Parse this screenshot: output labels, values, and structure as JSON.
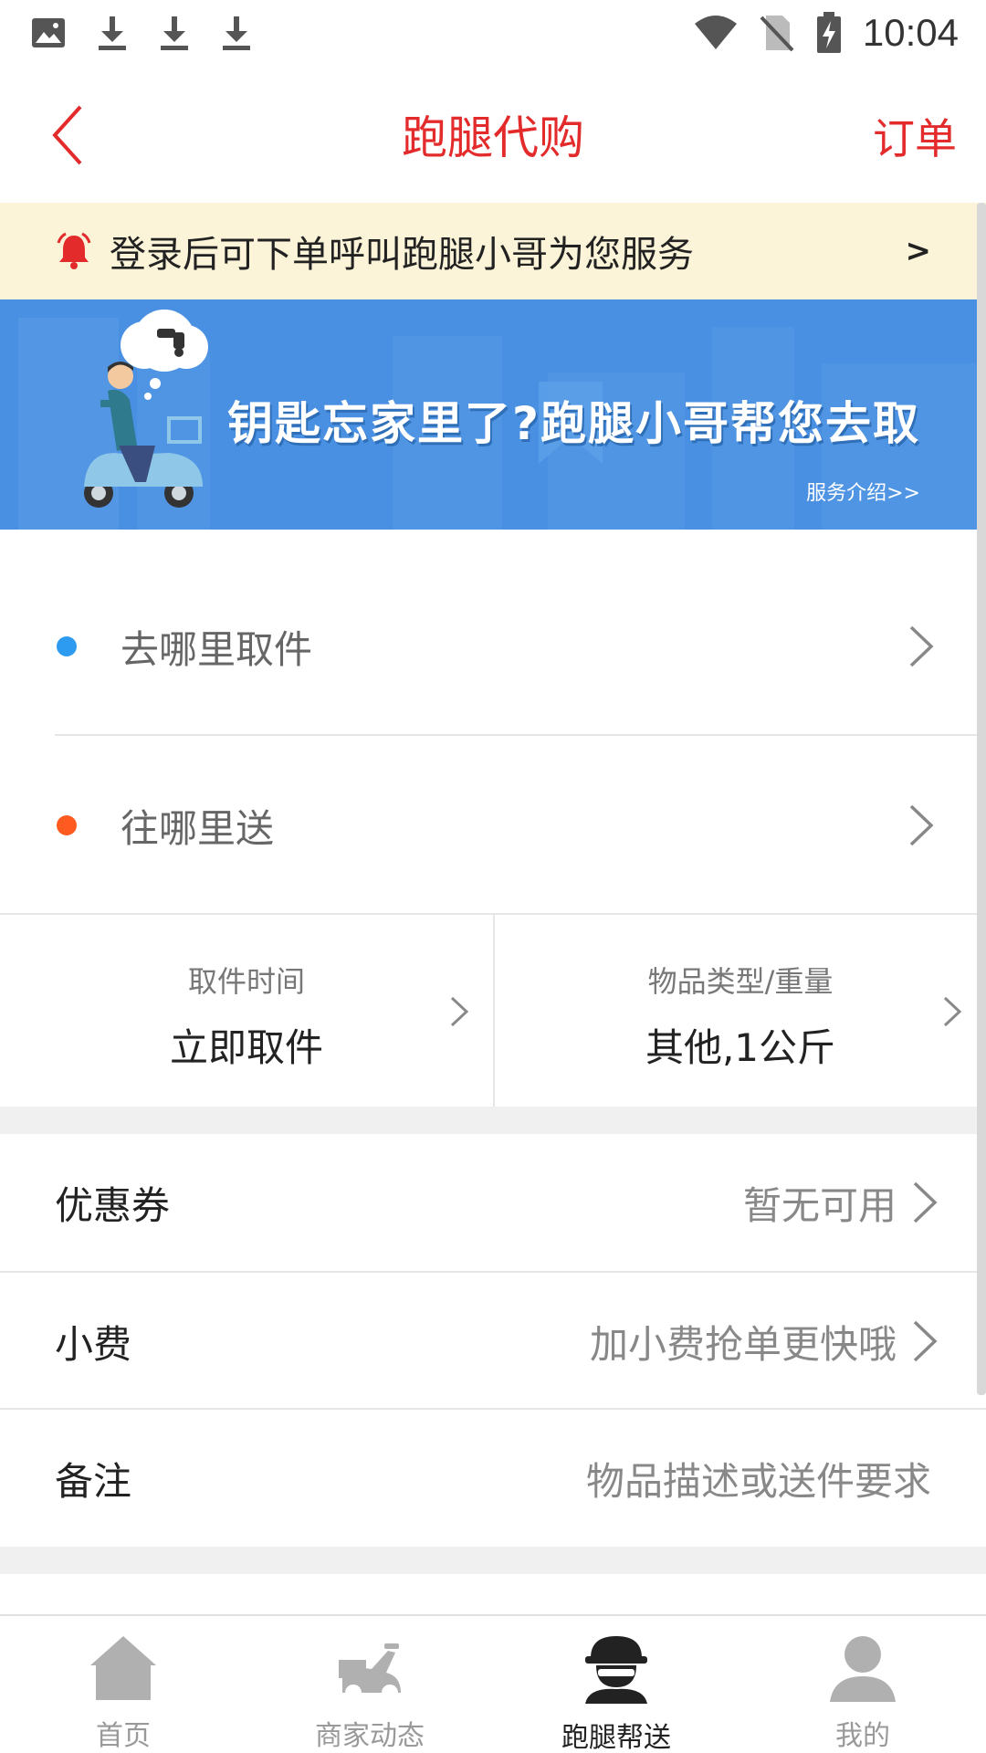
{
  "status_bar": {
    "time": "10:04",
    "icons": [
      "image-icon",
      "download-icon",
      "download-icon",
      "download-icon",
      "wifi-icon",
      "no-sim-icon",
      "battery-charging-icon"
    ]
  },
  "header": {
    "title": "跑腿代购",
    "order_label": "订单",
    "back_icon": "back-chevron-icon"
  },
  "notice": {
    "text": "登录后可下单呼叫跑腿小哥为您服务",
    "arrow": ">",
    "icon": "alarm-bell-icon"
  },
  "banner": {
    "headline": "钥匙忘家里了?跑腿小哥帮您去取",
    "link": "服务介绍>>"
  },
  "address": {
    "pickup": "去哪里取件",
    "dropoff": "往哪里送",
    "pickup_dot_color": "#2d9cf0",
    "dropoff_dot_color": "#ff5a1f"
  },
  "details": {
    "time_label": "取件时间",
    "time_value": "立即取件",
    "goods_label": "物品类型/重量",
    "goods_value": "其他,1公斤"
  },
  "options": {
    "coupon_label": "优惠券",
    "coupon_value": "暂无可用",
    "tip_label": "小费",
    "tip_value": "加小费抢单更快哦",
    "remark_label": "备注",
    "remark_value": "物品描述或送件要求"
  },
  "tabs": [
    {
      "label": "首页",
      "icon": "home-icon"
    },
    {
      "label": "商家动态",
      "icon": "scooter-icon"
    },
    {
      "label": "跑腿帮送",
      "icon": "courier-icon",
      "active": true
    },
    {
      "label": "我的",
      "icon": "user-icon"
    }
  ],
  "colors": {
    "accent": "#e32b2b",
    "banner": "#4a90e2",
    "notice_bg": "#fcf4d8"
  }
}
